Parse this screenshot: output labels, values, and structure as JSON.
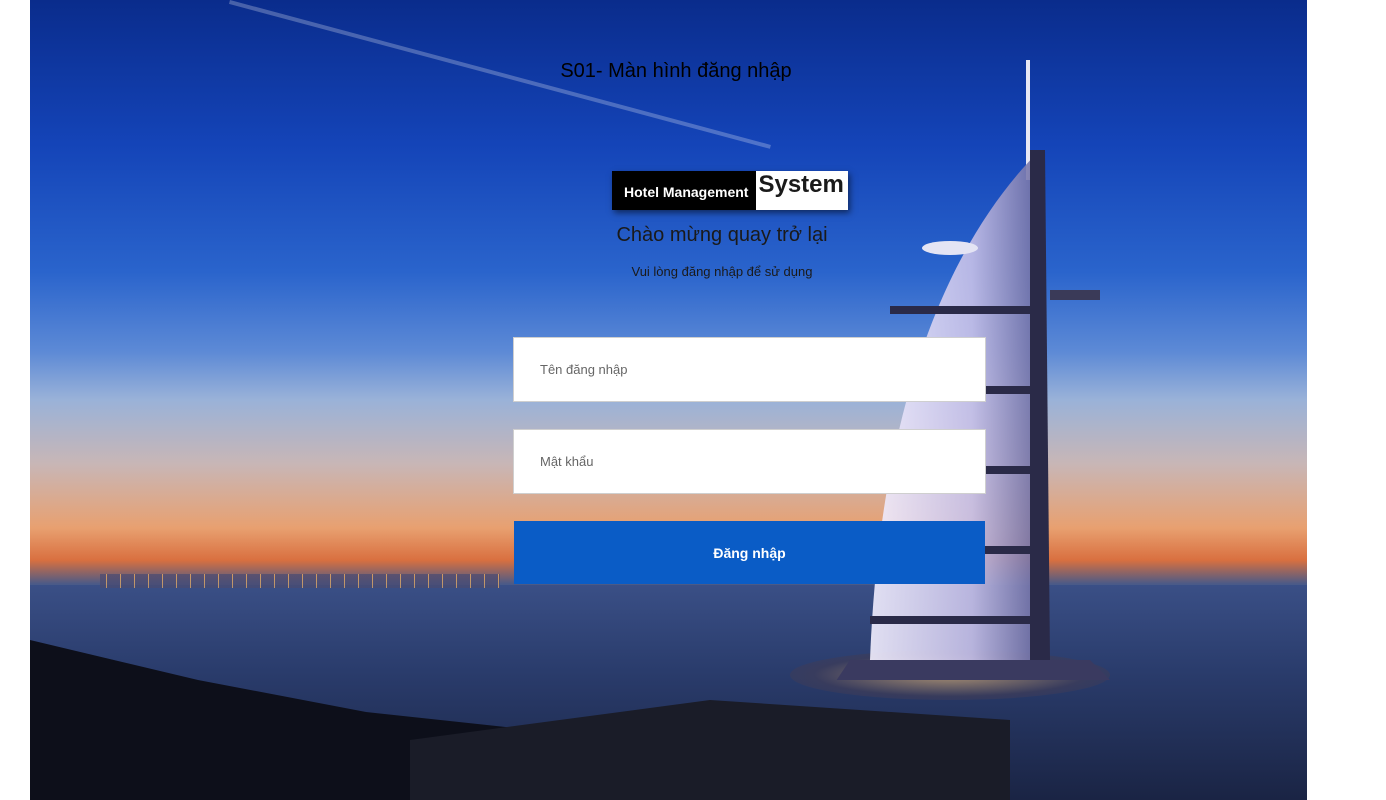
{
  "page": {
    "title": "S01- Màn hình đăng nhập"
  },
  "logo": {
    "left_text": "Hotel Management",
    "right_text": "System"
  },
  "login": {
    "welcome": "Chào mừng quay trở lại",
    "subtitle": "Vui lòng đăng nhập để sử dụng",
    "username_placeholder": "Tên đăng nhập",
    "username_value": "",
    "password_placeholder": "Mật khẩu",
    "password_value": "",
    "submit_label": "Đăng nhập"
  },
  "colors": {
    "button": "#0a5cc6",
    "logo_dark": "#000000",
    "logo_light": "#ffffff"
  }
}
